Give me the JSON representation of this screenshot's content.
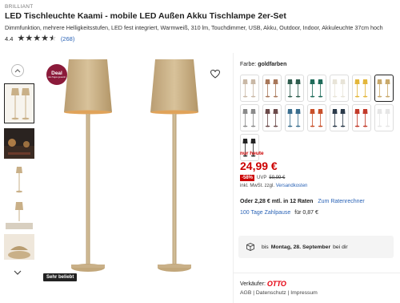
{
  "header": {
    "brand": "BRILLIANT",
    "title": "LED Tischleuchte Kaami - mobile LED Außen Akku Tischlampe 2er-Set",
    "subtitle": "Dimmfunktion, mehrere Helligkeitsstufen, LED fest integriert, Warmweiß, 310 lm, Touchdimmer, USB, Akku, Outdoor, Indoor, Akkuleuchte 37cm hoch"
  },
  "rating": {
    "value": "4.4",
    "stars": 4.5,
    "count": "(268)"
  },
  "gallery": {
    "deal_badge": {
      "title": "Deal",
      "subtitle": "des Tages gesenkt"
    },
    "bestseller_label": "Sehr beliebt",
    "thumbnails": [
      "two-lamps",
      "lamps-night",
      "lamp-single",
      "lamp-on-table",
      "lamp-head-closeup"
    ],
    "active_thumbnail": 0,
    "icons": {
      "up": "chevron-up-icon",
      "down": "chevron-down-icon",
      "wishlist": "heart-icon"
    }
  },
  "colors": {
    "label": "Farbe:",
    "selected_name": "goldfarben",
    "swatches": [
      {
        "color": "#c9b8a6"
      },
      {
        "color": "#a8775a"
      },
      {
        "color": "#2f5d4e"
      },
      {
        "color": "#1f6b5a"
      },
      {
        "color": "#e8e4d8"
      },
      {
        "color": "#e3b63a"
      },
      {
        "color": "#c9a96b"
      },
      {
        "color": "#8a8a8a"
      },
      {
        "color": "#6b4a4a"
      },
      {
        "color": "#3a6e8e"
      },
      {
        "color": "#c8502a"
      },
      {
        "color": "#2b3a4a"
      },
      {
        "color": "#c23a2a"
      },
      {
        "color": "#e6e6e6"
      },
      {
        "color": "#222222"
      }
    ],
    "selected_index": 6
  },
  "price": {
    "label": "nur heute",
    "current": "24,99 €",
    "discount": "-58%",
    "uvp_label": "UVP",
    "uvp_price": "59,99 €",
    "vat_text": "inkl. MwSt. zzgl.",
    "shipping_link": "Versandkosten"
  },
  "financing": {
    "installment_text": "Oder 2,28 € mtl. in 12 Raten",
    "calculator_link": "Zum Ratenrechner",
    "pause_link": "100 Tage Zahlpause",
    "pause_text": "für 0,87 €"
  },
  "delivery": {
    "prefix": "bis",
    "date": "Montag, 28. September",
    "suffix": "bei dir"
  },
  "seller": {
    "label": "Verkäufer:",
    "name": "OTTO",
    "legal": "AGB | Datenschutz | Impressum"
  },
  "theme": {
    "accent_red": "#cc0000",
    "link_blue": "#2a63b6",
    "lamp_gold": "#c9b088"
  }
}
